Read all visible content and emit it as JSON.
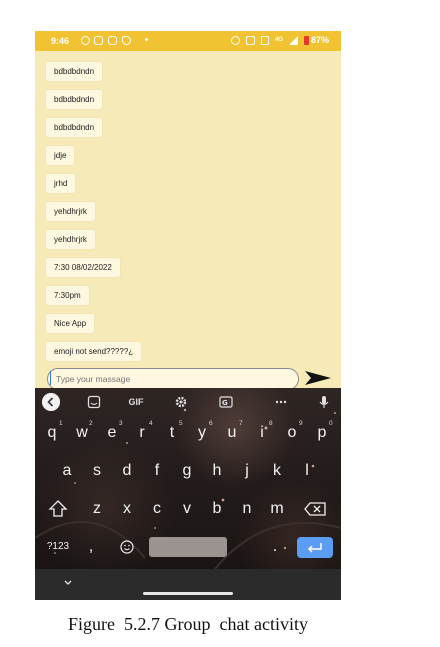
{
  "status_bar": {
    "time": "9:46",
    "network": "4G",
    "battery": "87%",
    "icons": [
      "whatsapp-icon",
      "chat-icon",
      "instagram-icon",
      "bird-icon",
      "dot-icon",
      "alarm-icon",
      "vibrate-icon",
      "lte-icon",
      "signal-icon",
      "battery-icon"
    ]
  },
  "messages": [
    "bdbdbdndn",
    "bdbdbdndn",
    "bdbdbdndn",
    "jdje",
    "jrhd",
    "yehdhrjrk",
    "yehdhrjrk",
    "7:30 08/02/2022",
    "7:30pm",
    "Nice App",
    "emoji not send?????¿"
  ],
  "composer": {
    "placeholder": "Type your massage",
    "send_icon": "send-arrow-icon"
  },
  "keyboard": {
    "toolbar": {
      "gif_label": "GIF",
      "icons": [
        "chevron-left-icon",
        "sticker-icon",
        "gif-icon",
        "settings-icon",
        "translate-icon",
        "more-icon",
        "mic-icon"
      ]
    },
    "row1": [
      "q",
      "w",
      "e",
      "r",
      "t",
      "y",
      "u",
      "i",
      "o",
      "p"
    ],
    "row1_hints": [
      "1",
      "2",
      "3",
      "4",
      "5",
      "6",
      "7",
      "8",
      "9",
      "0"
    ],
    "row2": [
      "a",
      "s",
      "d",
      "f",
      "g",
      "h",
      "j",
      "k",
      "l"
    ],
    "row3": [
      "z",
      "x",
      "c",
      "v",
      "b",
      "n",
      "m"
    ],
    "symbols_label": "?123",
    "comma": ",",
    "period": ".",
    "enter_color": "#5b9cf5"
  },
  "caption": "Figure  5.2.7 Group  chat activity",
  "colors": {
    "status_bar": "#f1c231",
    "chat_background": "#f6ebb8",
    "bubble": "#fdf8df",
    "battery_alert": "#e23b2e"
  }
}
